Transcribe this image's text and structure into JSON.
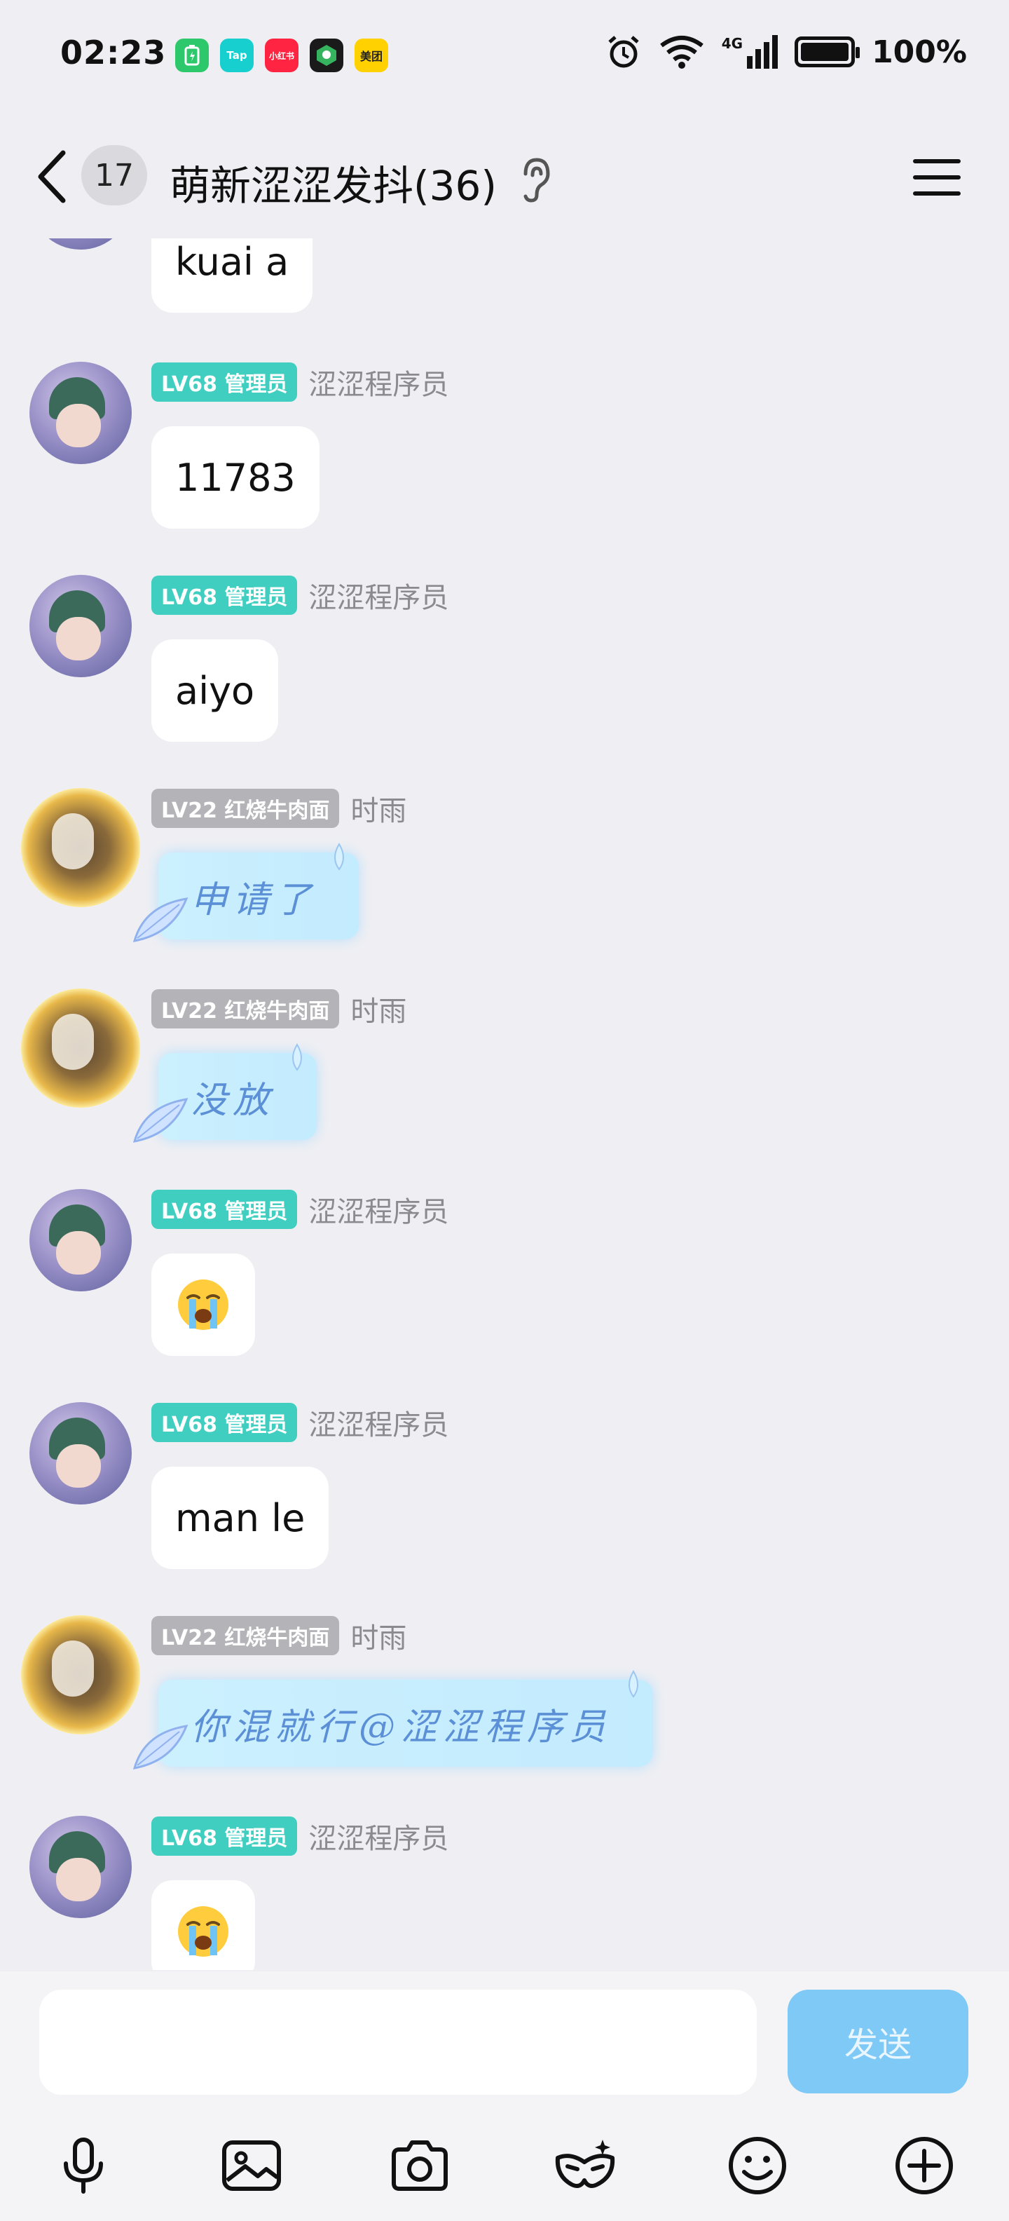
{
  "status_bar": {
    "time": "02:23",
    "apps": [
      {
        "name": "battery-app",
        "label": "",
        "color": "#2dc86b"
      },
      {
        "name": "taptap-app",
        "label": "Tap",
        "color": "#18cfd0"
      },
      {
        "name": "xiaohongshu-app",
        "label": "小红书",
        "color": "#ff2442"
      },
      {
        "name": "map-app",
        "label": "",
        "color": "#1f8a4a"
      },
      {
        "name": "meituan-app",
        "label": "美团",
        "color": "#ffd100"
      }
    ],
    "network": "4G",
    "battery": "100%"
  },
  "header": {
    "unread_count": "17",
    "title": "萌新涩涩发抖(36)"
  },
  "messages": [
    {
      "type": "text",
      "text": "kuai a"
    },
    {
      "type": "text",
      "badge": "LV68 管理员",
      "name": "涩涩程序员",
      "text": "11783"
    },
    {
      "type": "text",
      "badge": "LV68 管理员",
      "name": "涩涩程序员",
      "text": "aiyo"
    },
    {
      "type": "deco",
      "badge": "LV22 红烧牛肉面",
      "name": "时雨",
      "text": "申请了"
    },
    {
      "type": "deco",
      "badge": "LV22 红烧牛肉面",
      "name": "时雨",
      "text": "没放"
    },
    {
      "type": "emoji",
      "badge": "LV68 管理员",
      "name": "涩涩程序员",
      "emoji": "loudly-crying-face"
    },
    {
      "type": "text",
      "badge": "LV68 管理员",
      "name": "涩涩程序员",
      "text": "man le"
    },
    {
      "type": "deco",
      "badge": "LV22 红烧牛肉面",
      "name": "时雨",
      "text": "你混就行@涩涩程序员"
    },
    {
      "type": "emoji",
      "badge": "LV68 管理员",
      "name": "涩涩程序员",
      "emoji": "loudly-crying-face"
    }
  ],
  "input": {
    "placeholder": "",
    "send_label": "发送"
  },
  "toolbar": [
    "microphone-icon",
    "image-icon",
    "camera-icon",
    "mask-icon",
    "emoji-icon",
    "plus-icon"
  ],
  "colors": {
    "background": "#efeff3",
    "admin_badge": "#3fcec0",
    "level_badge": "#b3b3b8",
    "send_button": "#7fc9f6",
    "deco_text": "#5b8fd6"
  }
}
